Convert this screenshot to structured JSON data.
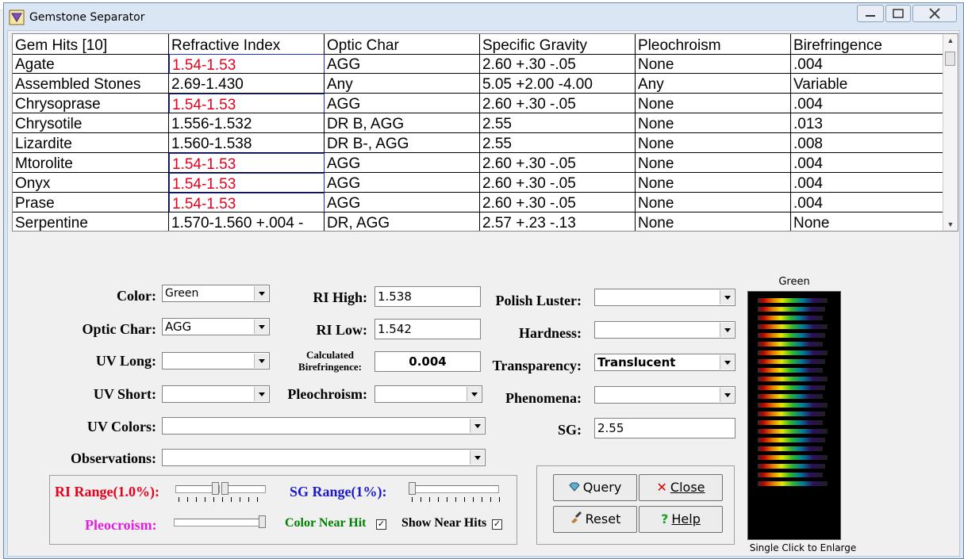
{
  "window": {
    "title": "Gemstone Separator"
  },
  "grid": {
    "headers": [
      "Gem Hits [10]",
      "Refractive Index",
      "Optic Char",
      "Specific Gravity",
      "Pleochroism",
      "Birefringence"
    ],
    "rows": [
      {
        "gem": "Agate",
        "ri": "1.54-1.53",
        "optic": "AGG",
        "sg": "2.60 +.30 -.05",
        "pleo": "None",
        "biref": ".004",
        "ri_hit": true
      },
      {
        "gem": "Assembled Stones",
        "ri": "2.69-1.430",
        "optic": "Any",
        "sg": "5.05 +2.00 -4.00",
        "pleo": "Any",
        "biref": "Variable",
        "ri_hit": false
      },
      {
        "gem": "Chrysoprase",
        "ri": "1.54-1.53",
        "optic": "AGG",
        "sg": "2.60 +.30 -.05",
        "pleo": "None",
        "biref": ".004",
        "ri_hit": true
      },
      {
        "gem": "Chrysotile",
        "ri": "1.556-1.532",
        "optic": "DR B, AGG",
        "sg": "2.55",
        "pleo": "None",
        "biref": ".013",
        "ri_hit": false
      },
      {
        "gem": "Lizardite",
        "ri": "1.560-1.538",
        "optic": "DR B-, AGG",
        "sg": "2.55",
        "pleo": "None",
        "biref": ".008",
        "ri_hit": false
      },
      {
        "gem": "Mtorolite",
        "ri": "1.54-1.53",
        "optic": "AGG",
        "sg": "2.60 +.30 -.05",
        "pleo": "None",
        "biref": ".004",
        "ri_hit": true
      },
      {
        "gem": "Onyx",
        "ri": "1.54-1.53",
        "optic": "AGG",
        "sg": "2.60 +.30 -.05",
        "pleo": "None",
        "biref": ".004",
        "ri_hit": true
      },
      {
        "gem": "Prase",
        "ri": "1.54-1.53",
        "optic": "AGG",
        "sg": "2.60 +.30 -.05",
        "pleo": "None",
        "biref": ".004",
        "ri_hit": true
      },
      {
        "gem": "Serpentine",
        "ri": "1.570-1.560  +.004 -",
        "optic": "DR, AGG",
        "sg": "2.57 +.23 -.13",
        "pleo": "None",
        "biref": "None",
        "ri_hit": false
      }
    ]
  },
  "form": {
    "color_label": "Color:",
    "color_value": "Green",
    "optic_label": "Optic Char:",
    "optic_value": "AGG",
    "uv_long_label": "UV Long:",
    "uv_long_value": "",
    "uv_short_label": "UV Short:",
    "uv_short_value": "",
    "uv_colors_label": "UV Colors:",
    "uv_colors_value": "",
    "observations_label": "Observations:",
    "observations_value": "",
    "ri_high_label": "RI High:",
    "ri_high_value": "1.538",
    "ri_low_label": "RI Low:",
    "ri_low_value": "1.542",
    "calc_biref_label_1": "Calculated",
    "calc_biref_label_2": "Birefringence:",
    "calc_biref_value": "0.004",
    "pleo_label": "Pleochroism:",
    "pleo_value": "",
    "polish_label": "Polish Luster:",
    "polish_value": "",
    "hardness_label": "Hardness:",
    "hardness_value": "",
    "transparency_label": "Transparency:",
    "transparency_value": "Translucent",
    "phenomena_label": "Phenomena:",
    "phenomena_value": "",
    "sg_label": "SG:",
    "sg_value": "2.55"
  },
  "ranges": {
    "ri_range_label": "RI Range(1.0%):",
    "sg_range_label": "SG Range(1%):",
    "pleo_label": "Pleocroism:",
    "color_near_hit_label": "Color Near Hit",
    "show_near_hits_label": "Show Near Hits",
    "color_near_hit_checked": true,
    "show_near_hits_checked": true,
    "colors": {
      "ri": "#e8001c",
      "sg": "#1a1acc",
      "pleo": "#e020e0",
      "near": "#008000"
    }
  },
  "buttons": {
    "query": "Query",
    "close": "Close",
    "reset": "Reset",
    "help": "Help"
  },
  "thumbnail": {
    "title": "Green",
    "caption": "Single Click to Enlarge"
  }
}
